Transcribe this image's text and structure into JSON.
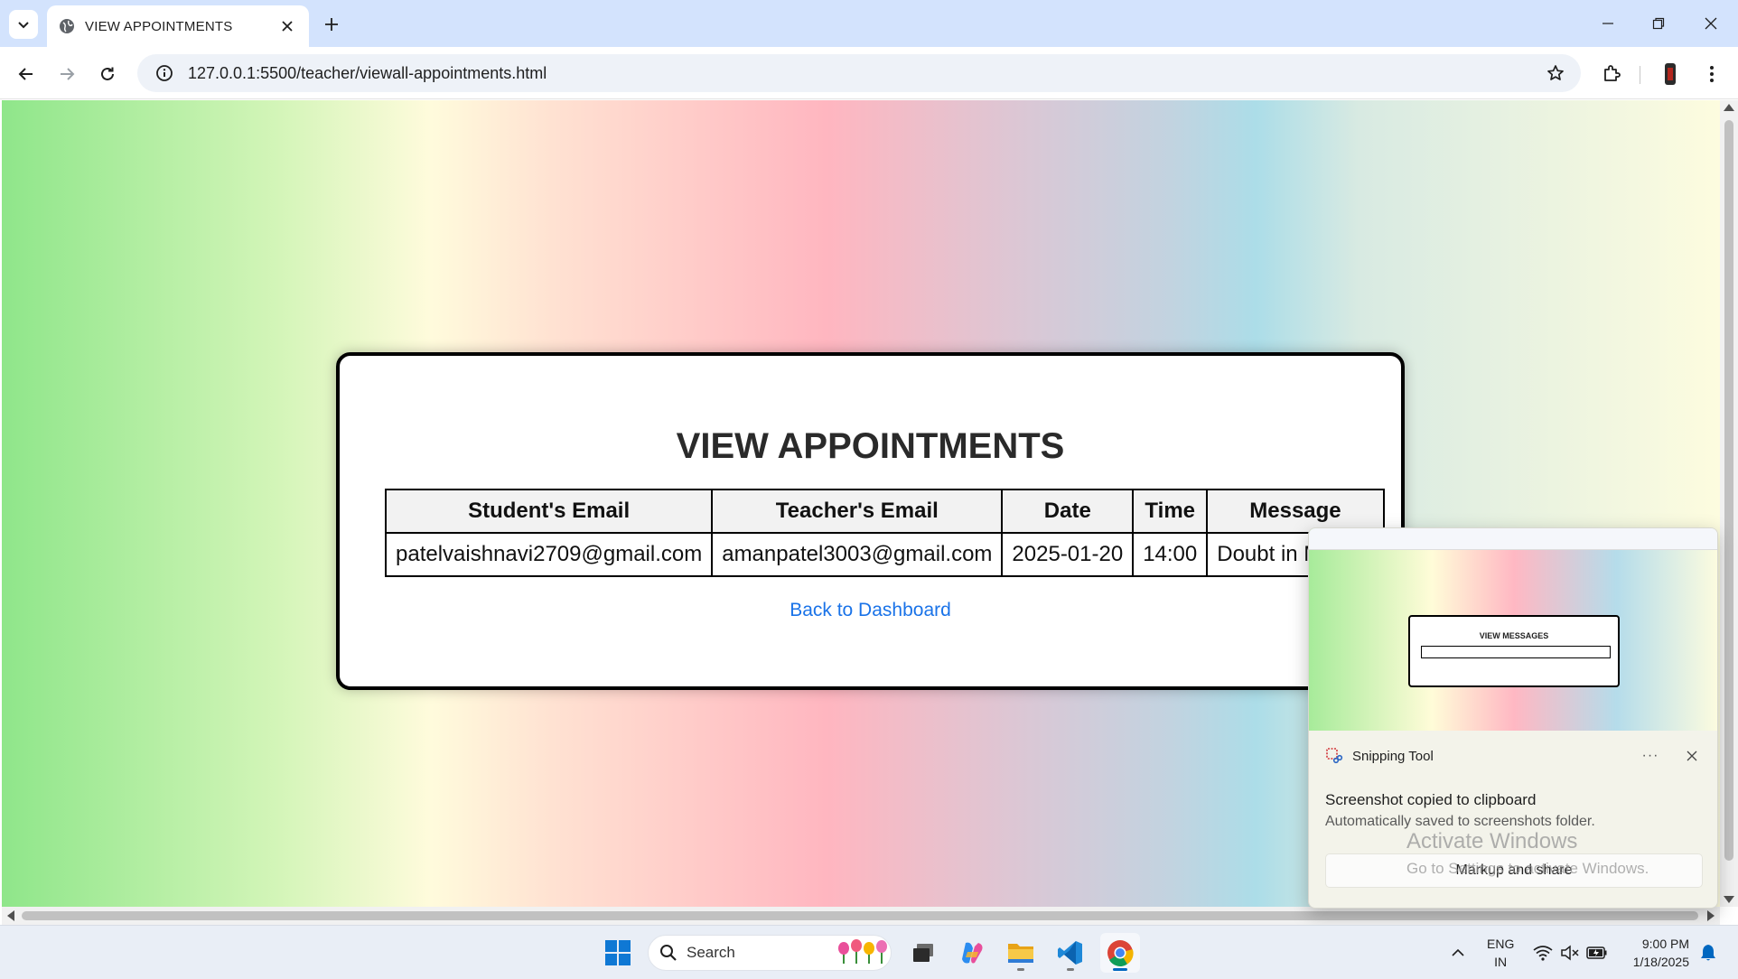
{
  "browser": {
    "tab_title": "VIEW APPOINTMENTS",
    "url": "127.0.0.1:5500/teacher/viewall-appointments.html"
  },
  "page": {
    "heading": "VIEW APPOINTMENTS",
    "table": {
      "headers": [
        "Student's Email",
        "Teacher's Email",
        "Date",
        "Time",
        "Message"
      ],
      "rows": [
        [
          "patelvaishnavi2709@gmail.com",
          "amanpatel3003@gmail.com",
          "2025-01-20",
          "14:00",
          "Doubt in Metallu"
        ]
      ]
    },
    "back_link": "Back to Dashboard"
  },
  "toast": {
    "preview_title": "VIEW MESSAGES",
    "app_name": "Snipping Tool",
    "more_label": "···",
    "message": "Screenshot copied to clipboard",
    "submessage": "Automatically saved to screenshots folder.",
    "action_label": "Markup and share"
  },
  "watermark": {
    "line1": "Activate Windows",
    "line2": "Go to Settings to activate Windows."
  },
  "taskbar": {
    "search_label": "Search",
    "lang_line1": "ENG",
    "lang_line2": "IN",
    "time": "9:00 PM",
    "date": "1/18/2025"
  },
  "colors": {
    "accent": "#1a73e8",
    "tabbar": "#d3e3fd",
    "windows_blue": "#0067c0"
  }
}
